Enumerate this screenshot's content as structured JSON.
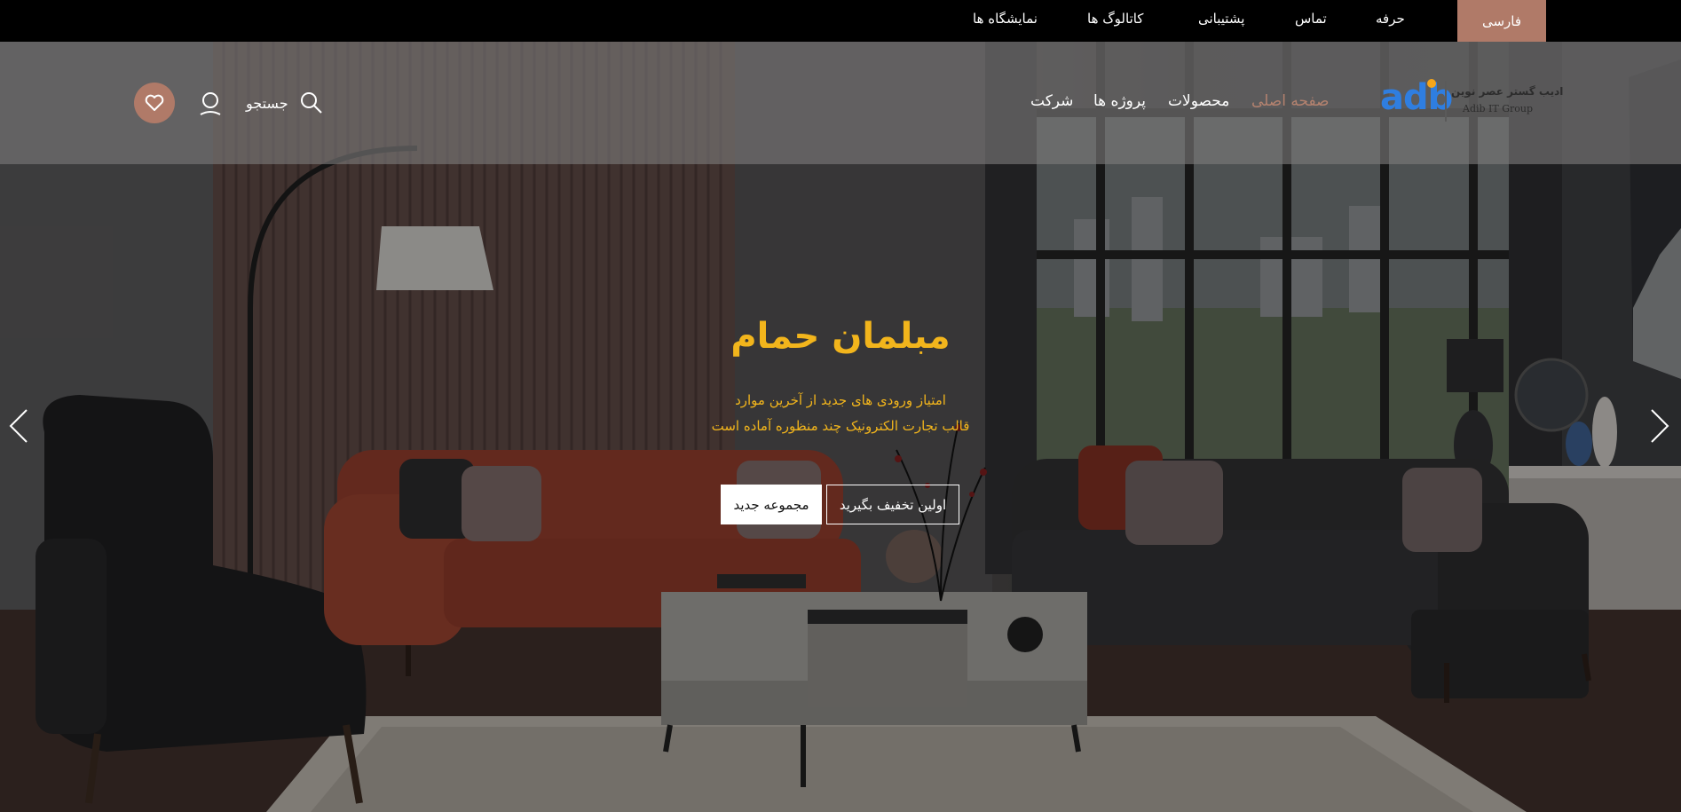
{
  "topbar": {
    "language": "فارسی",
    "links": [
      "حرفه",
      "تماس",
      "پشتیبانی",
      "کاتالوگ ها",
      "نمایشگاه ها"
    ]
  },
  "nav": {
    "links": [
      "صفحه اصلی",
      "محصولات",
      "پروژه ها",
      "شرکت"
    ],
    "active_index": 0,
    "search_label": "جستجو"
  },
  "logo": {
    "mark": "adb",
    "name_fa": "ادیب گستر عصر نوین",
    "name_en": "Adib IT Group"
  },
  "hero": {
    "title": "مبلمان حمام",
    "subtitle_line1": "امتیاز ورودی های جدید از آخرین موارد",
    "subtitle_line2": "قالب تجارت الکترونیک چند منظوره آماده است",
    "button_primary": "اولین تخفیف بگیرید",
    "button_secondary": "مجموعه جدید"
  },
  "colors": {
    "accent": "#b07a68",
    "title_yellow": "#f2b51c",
    "active_nav": "#b4826f"
  },
  "icons": [
    "search-icon",
    "user-icon",
    "heart-icon",
    "chevron-left-icon",
    "chevron-right-icon"
  ]
}
